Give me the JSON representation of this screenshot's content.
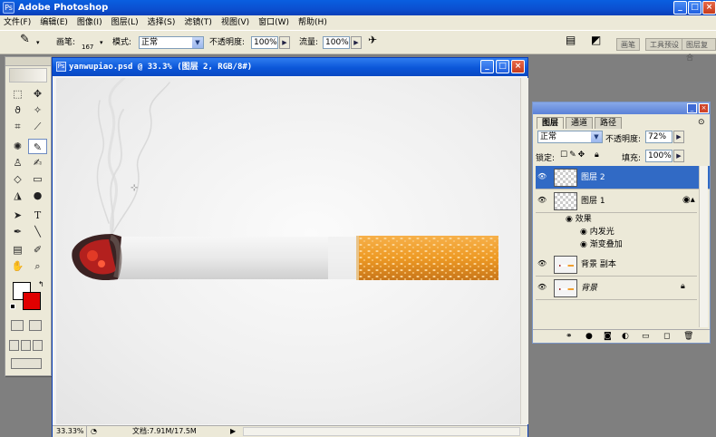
{
  "app": {
    "title": "Adobe Photoshop",
    "colors": {
      "titlebar": "#0b4fd0",
      "chrome": "#ece9d8",
      "accent_selected": "#316ac5"
    }
  },
  "window_controls": {
    "minimize": "_",
    "maximize": "□",
    "close": "×"
  },
  "menubar": {
    "items": [
      "文件(F)",
      "编辑(E)",
      "图像(I)",
      "图层(L)",
      "选择(S)",
      "滤镜(T)",
      "视图(V)",
      "窗口(W)",
      "帮助(H)"
    ]
  },
  "options": {
    "brush_label": "画笔:",
    "brush_size": "167",
    "mode_label": "模式:",
    "mode_value": "正常",
    "opacity_label": "不透明度:",
    "opacity_value": "100%",
    "flow_label": "流量:",
    "flow_value": "100%",
    "workspace_tabs": [
      "画笔",
      "工具预设",
      "图层复合"
    ]
  },
  "document": {
    "title": "yanwupiao.psd @ 33.3% (图层 2, RGB/8#)",
    "zoom": "33.33%",
    "doc_size": "文档:7.91M/17.5M"
  },
  "layers_panel": {
    "tabs": [
      "图层",
      "通道",
      "路径"
    ],
    "blend_mode": "正常",
    "opacity_label": "不透明度:",
    "opacity_value": "72%",
    "lock_label": "锁定:",
    "fill_label": "填充:",
    "fill_value": "100%",
    "layers": [
      {
        "name": "图层 2",
        "selected": true
      },
      {
        "name": "图层 1",
        "selected": false
      }
    ],
    "effects_label": "效果",
    "effects": [
      "内发光",
      "渐变叠加"
    ],
    "bg_copy": "背景 副本",
    "background": "背景"
  },
  "icons": {
    "eye": "eye-icon",
    "lock": "lock-icon",
    "fx": "fx-icon",
    "trash": "trash-icon",
    "new_layer": "new-layer-icon"
  }
}
